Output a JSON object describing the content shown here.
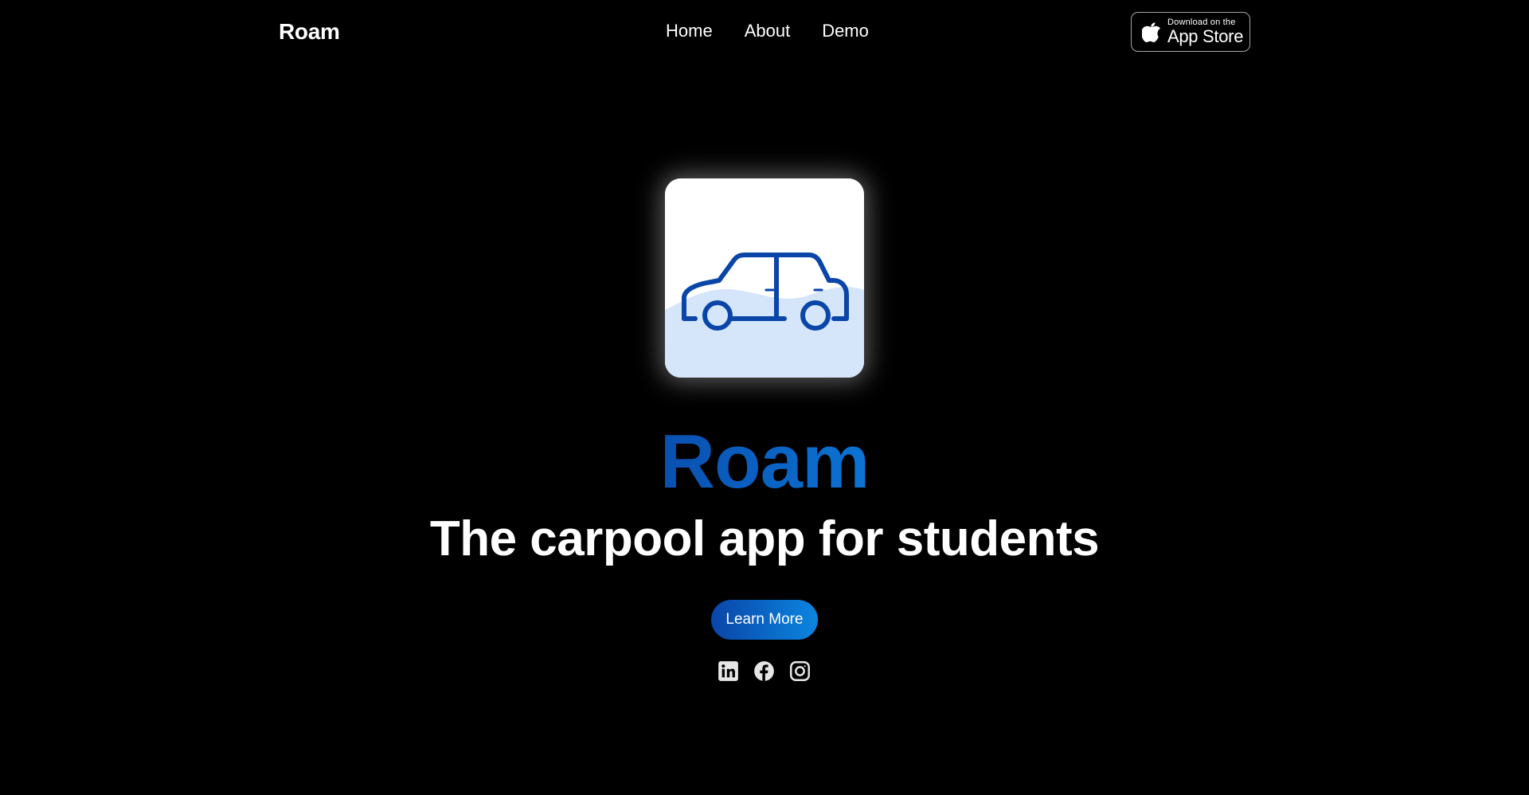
{
  "nav": {
    "brand": "Roam",
    "links": [
      "Home",
      "About",
      "Demo"
    ],
    "app_store": {
      "small": "Download on the",
      "big": "App Store"
    }
  },
  "hero": {
    "title": "Roam",
    "subtitle": "The carpool app for students",
    "cta": "Learn More"
  },
  "icons": {
    "app_icon": "car-icon",
    "social": [
      "linkedin-icon",
      "facebook-icon",
      "instagram-icon"
    ]
  },
  "colors": {
    "background": "#000000",
    "accent_start": "#0a4fb0",
    "accent_end": "#0b86e0",
    "icon_wave": "#d6e6fa"
  }
}
